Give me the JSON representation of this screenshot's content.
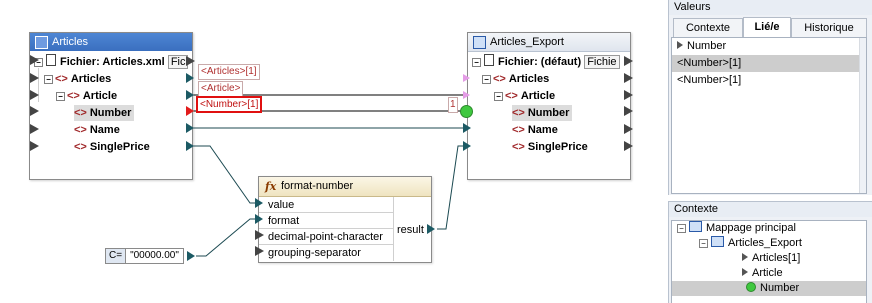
{
  "source_component": {
    "title": "Articles",
    "file_label": "Fichier: Articles.xml",
    "file_button": "Fic",
    "nodes": [
      "Articles",
      "Article",
      "Number",
      "Name",
      "SinglePrice"
    ]
  },
  "target_component": {
    "title": "Articles_Export",
    "file_label": "Fichier: (défaut)",
    "file_button": "Fichie",
    "nodes": [
      "Articles",
      "Article",
      "Number",
      "Name",
      "SinglePrice"
    ]
  },
  "context_tips": {
    "articles": "<Articles>[1]",
    "article": "<Article>",
    "number": "<Number>[1]",
    "target_index": "1"
  },
  "function": {
    "name": "format-number",
    "fx_symbol": "fx",
    "inputs": [
      "value",
      "format",
      "decimal-point-character",
      "grouping-separator"
    ],
    "output": "result"
  },
  "constant": {
    "type": "C=",
    "value": "\"00000.00\""
  },
  "values_panel": {
    "title": "Valeurs",
    "tabs": [
      "Contexte",
      "Lié/e",
      "Historique"
    ],
    "active_tab": "Lié/e",
    "items": [
      "Number",
      "<Number>[1]",
      "<Number>[1]"
    ]
  },
  "context_panel": {
    "title": "Contexte",
    "tree": [
      "Mappage principal",
      "Articles_Export",
      "Articles[1]",
      "Article",
      "Number"
    ]
  }
}
